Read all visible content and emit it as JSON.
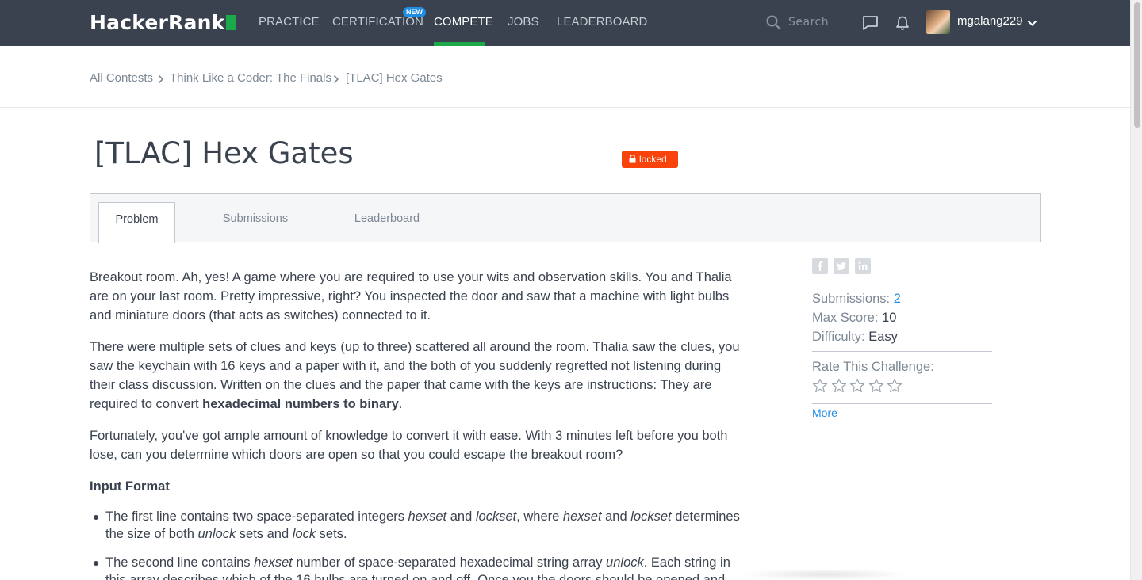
{
  "nav": {
    "logo": "HackerRank",
    "items": [
      {
        "label": "PRACTICE"
      },
      {
        "label": "CERTIFICATION"
      },
      {
        "label": "COMPETE"
      },
      {
        "label": "JOBS"
      },
      {
        "label": "LEADERBOARD"
      }
    ],
    "new_badge": "NEW",
    "search_placeholder": "Search",
    "username": "mgalang229",
    "icons": [
      "search-icon",
      "chat-icon",
      "bell-icon",
      "chevron-down-icon"
    ],
    "active_accent": "#1ba94c"
  },
  "breadcrumb": [
    "All Contests",
    "Think Like a Coder: The Finals",
    "[TLAC] Hex Gates"
  ],
  "title": "[TLAC] Hex Gates",
  "locked_label": "locked",
  "tabs": [
    "Problem",
    "Submissions",
    "Leaderboard"
  ],
  "problem": {
    "p1": "Breakout room. Ah, yes! A game where you are required to use your wits and observation skills. You and Thalia are on your last room. Pretty impressive, right? You inspected the door and saw that a machine with light bulbs and miniature doors (that acts as switches) connected to it.",
    "p2_before": "There were multiple sets of clues and keys (up to three) scattered all around the room. Thalia saw the clues, you saw the keychain with 16 keys and a paper with it, and the both of you suddenly regretted not listening during their class discussion. Written on the clues and the paper that came with the keys are instructions: They are required to convert ",
    "p2_bold": "hexadecimal numbers to binary",
    "p2_after": ".",
    "p3": "Fortunately, you've got ample amount of knowledge to convert it with ease. With 3 minutes left before you both lose, can you determine which doors are open so that you could escape the breakout room?",
    "input_format_heading": "Input Format",
    "bullet1": {
      "t1": "The first line contains two space-separated integers ",
      "i1": "hexset",
      "t2": " and ",
      "i2": "lockset",
      "t3": ", where ",
      "i3": "hexset",
      "t4": " and ",
      "i4": "lockset",
      "t5": " determines the size of both ",
      "i5": "unlock",
      "t6": " sets and ",
      "i6": "lock",
      "t7": " sets."
    },
    "bullet2": {
      "t1": "The second line contains ",
      "i1": "hexset",
      "t2": " number of space-separated hexadecimal string array ",
      "i2": "unlock",
      "t3": ". Each string in this array describes which of the 16 bulbs are turned on and off. Once you the doors should be opened and"
    }
  },
  "sidebar": {
    "share_icons": [
      "facebook-icon",
      "twitter-icon",
      "linkedin-icon"
    ],
    "submissions_label": "Submissions:",
    "submissions_value": "2",
    "max_score_label": "Max Score:",
    "max_score_value": "10",
    "difficulty_label": "Difficulty:",
    "difficulty_value": "Easy",
    "rate_label": "Rate This Challenge:",
    "rating": 0,
    "rating_max": 5,
    "more_label": "More"
  }
}
